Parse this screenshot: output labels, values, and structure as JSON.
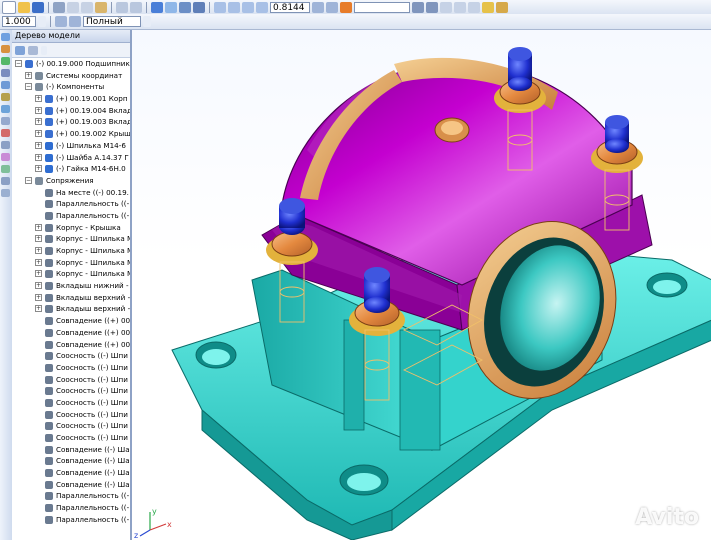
{
  "toolbar": {
    "scale_value": "1.000",
    "display_mode": "Полный",
    "zoom_value": "0.8144"
  },
  "tree": {
    "panel_title": "Дерево модели",
    "items": [
      {
        "label": "(-) 00.19.000 Подшипник (Те",
        "level": 0,
        "exp": "-",
        "icon": "#3a6fd0"
      },
      {
        "label": "Системы координат",
        "level": 1,
        "exp": "+",
        "icon": "#7a8a9a"
      },
      {
        "label": "(-) Компоненты",
        "level": 1,
        "exp": "-",
        "icon": "#7a8a9a"
      },
      {
        "label": "(+) 00.19.001 Корп",
        "level": 2,
        "exp": "+",
        "icon": "#3a6fd0"
      },
      {
        "label": "(+) 00.19.004 Вклад",
        "level": 2,
        "exp": "+",
        "icon": "#3a6fd0"
      },
      {
        "label": "(+) 00.19.003 Вклад",
        "level": 2,
        "exp": "+",
        "icon": "#3a6fd0"
      },
      {
        "label": "(+) 00.19.002 Крыш",
        "level": 2,
        "exp": "+",
        "icon": "#3a6fd0"
      },
      {
        "label": "(-) Шпилька М14-6",
        "level": 2,
        "exp": "+",
        "icon": "#2f6dd1"
      },
      {
        "label": "(-) Шайба А.14.37 Г",
        "level": 2,
        "exp": "+",
        "icon": "#2f6dd1"
      },
      {
        "label": "(-) Гайка М14-6Н.0",
        "level": 2,
        "exp": "+",
        "icon": "#2f6dd1"
      },
      {
        "label": "Сопряжения",
        "level": 1,
        "exp": "-",
        "icon": "#7a8a9a"
      },
      {
        "label": "На месте ((-) 00.19.",
        "level": 2,
        "exp": "",
        "icon": "#6a7a90"
      },
      {
        "label": "Параллельность ((-",
        "level": 2,
        "exp": "",
        "icon": "#6a7a90"
      },
      {
        "label": "Параллельность ((-",
        "level": 2,
        "exp": "",
        "icon": "#6a7a90"
      },
      {
        "label": "Корпус - Крышка",
        "level": 2,
        "exp": "+",
        "icon": "#6a7a90"
      },
      {
        "label": "Корпус - Шпилька М",
        "level": 2,
        "exp": "+",
        "icon": "#6a7a90"
      },
      {
        "label": "Корпус - Шпилька М",
        "level": 2,
        "exp": "+",
        "icon": "#6a7a90"
      },
      {
        "label": "Корпус - Шпилька М",
        "level": 2,
        "exp": "+",
        "icon": "#6a7a90"
      },
      {
        "label": "Корпус - Шпилька М",
        "level": 2,
        "exp": "+",
        "icon": "#6a7a90"
      },
      {
        "label": "Вкладыш нижний -",
        "level": 2,
        "exp": "+",
        "icon": "#6a7a90"
      },
      {
        "label": "Вкладыш верхний -",
        "level": 2,
        "exp": "+",
        "icon": "#6a7a90"
      },
      {
        "label": "Вкладыш верхний -",
        "level": 2,
        "exp": "+",
        "icon": "#6a7a90"
      },
      {
        "label": "Совпадение ((+) 00",
        "level": 2,
        "exp": "",
        "icon": "#6a7a90"
      },
      {
        "label": "Совпадение ((+) 00",
        "level": 2,
        "exp": "",
        "icon": "#6a7a90"
      },
      {
        "label": "Совпадение ((+) 00",
        "level": 2,
        "exp": "",
        "icon": "#6a7a90"
      },
      {
        "label": "Соосность ((-) Шпи",
        "level": 2,
        "exp": "",
        "icon": "#6a7a90"
      },
      {
        "label": "Соосность ((-) Шпи",
        "level": 2,
        "exp": "",
        "icon": "#6a7a90"
      },
      {
        "label": "Соосность ((-) Шпи",
        "level": 2,
        "exp": "",
        "icon": "#6a7a90"
      },
      {
        "label": "Соосность ((-) Шпи",
        "level": 2,
        "exp": "",
        "icon": "#6a7a90"
      },
      {
        "label": "Соосность ((-) Шпи",
        "level": 2,
        "exp": "",
        "icon": "#6a7a90"
      },
      {
        "label": "Соосность ((-) Шпи",
        "level": 2,
        "exp": "",
        "icon": "#6a7a90"
      },
      {
        "label": "Соосность ((-) Шпи",
        "level": 2,
        "exp": "",
        "icon": "#6a7a90"
      },
      {
        "label": "Соосность ((-) Шпи",
        "level": 2,
        "exp": "",
        "icon": "#6a7a90"
      },
      {
        "label": "Совпадение ((-) Ша",
        "level": 2,
        "exp": "",
        "icon": "#6a7a90"
      },
      {
        "label": "Совпадение ((-) Ша",
        "level": 2,
        "exp": "",
        "icon": "#6a7a90"
      },
      {
        "label": "Совпадение ((-) Ша",
        "level": 2,
        "exp": "",
        "icon": "#6a7a90"
      },
      {
        "label": "Совпадение ((-) Ша",
        "level": 2,
        "exp": "",
        "icon": "#6a7a90"
      },
      {
        "label": "Параллельность ((-",
        "level": 2,
        "exp": "",
        "icon": "#6a7a90"
      },
      {
        "label": "Параллельность ((-",
        "level": 2,
        "exp": "",
        "icon": "#6a7a90"
      },
      {
        "label": "Параллельность ((-",
        "level": 2,
        "exp": "",
        "icon": "#6a7a90"
      }
    ]
  },
  "viewport": {
    "axis_labels": {
      "x": "x",
      "y": "y",
      "z": "z"
    },
    "colors": {
      "cap": "#9a0aa6",
      "base": "#33d6cf",
      "liner": "#e2a96a",
      "nut": "#e68a4a",
      "stud": "#1c2fc4",
      "background": "#ffffff"
    }
  },
  "watermark": {
    "text": "Avito"
  }
}
